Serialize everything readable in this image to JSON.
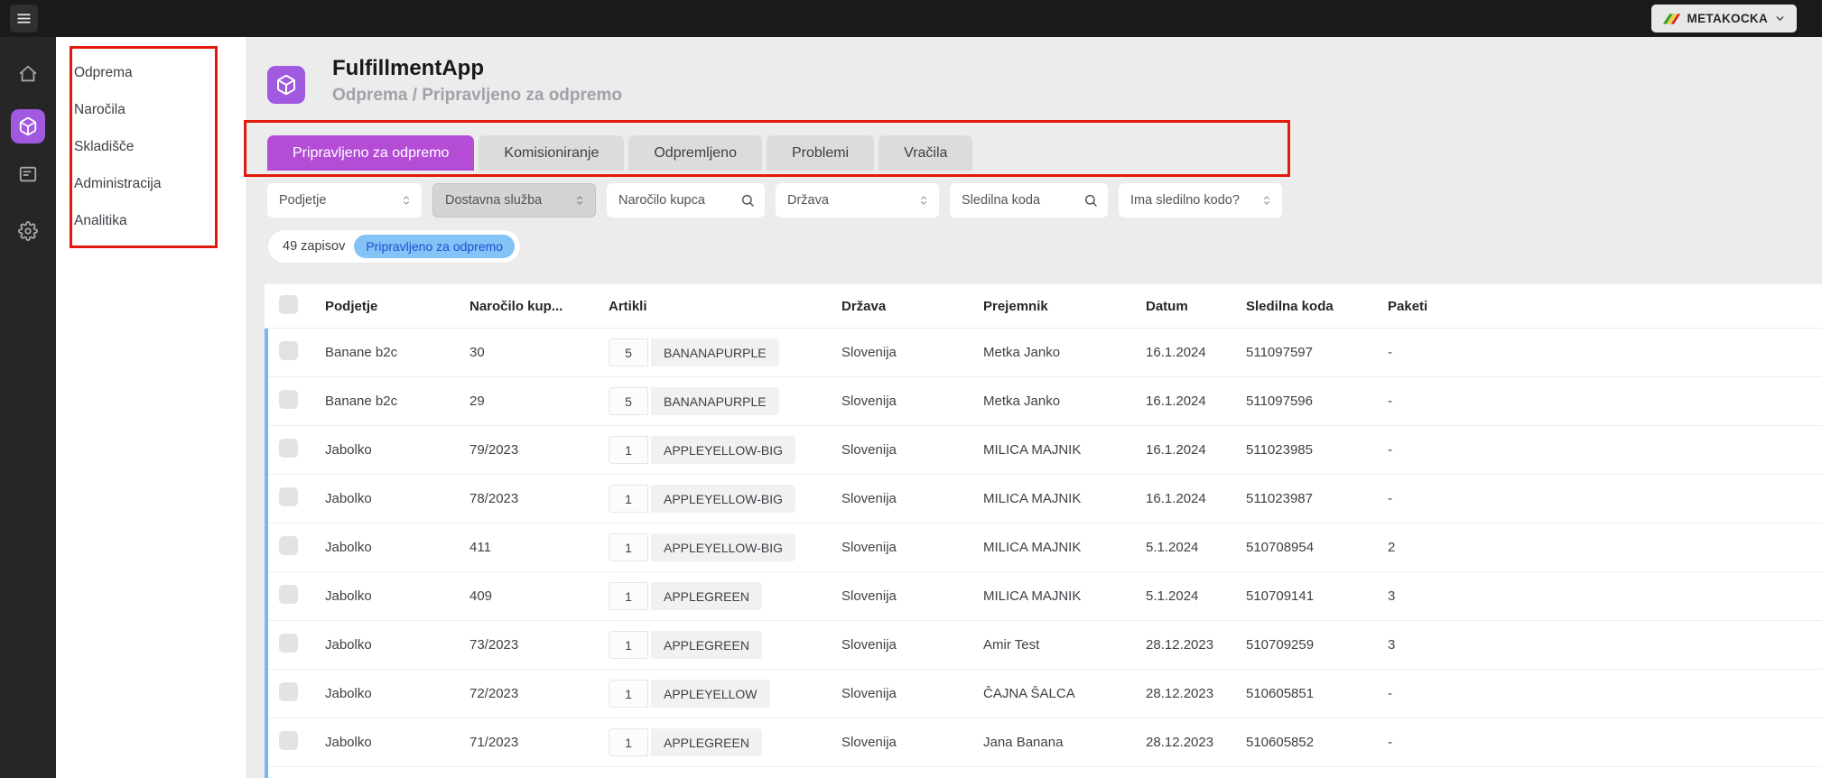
{
  "topbar": {
    "brand": "METAKOCKA"
  },
  "iconbar": {
    "items": [
      {
        "name": "home",
        "active": false
      },
      {
        "name": "fulfillment-cube",
        "active": true
      },
      {
        "name": "forms",
        "active": false
      },
      {
        "name": "settings",
        "active": false
      }
    ]
  },
  "sidebar": {
    "items": [
      {
        "label": "Odprema"
      },
      {
        "label": "Naročila"
      },
      {
        "label": "Skladišče"
      },
      {
        "label": "Administracija"
      },
      {
        "label": "Analitika"
      }
    ]
  },
  "header": {
    "title": "FulfillmentApp",
    "breadcrumb": "Odprema / Pripravljeno za odpremo"
  },
  "tabs": [
    {
      "label": "Pripravljeno za odpremo",
      "active": true
    },
    {
      "label": "Komisioniranje",
      "active": false
    },
    {
      "label": "Odpremljeno",
      "active": false
    },
    {
      "label": "Problemi",
      "active": false
    },
    {
      "label": "Vračila",
      "active": false
    }
  ],
  "filters": [
    {
      "label": "Podjetje",
      "type": "select"
    },
    {
      "label": "Dostavna služba",
      "type": "select",
      "disabled": true
    },
    {
      "label": "Naročilo kupca",
      "type": "search",
      "value": ""
    },
    {
      "label": "Država",
      "type": "select"
    },
    {
      "label": "Sledilna koda",
      "type": "search",
      "value": ""
    },
    {
      "label": "Ima sledilno kodo?",
      "type": "select"
    }
  ],
  "results": {
    "count_label": "49 zapisov",
    "status_label": "Pripravljeno za odpremo"
  },
  "table": {
    "columns": [
      "Podjetje",
      "Naročilo kup...",
      "Artikli",
      "Država",
      "Prejemnik",
      "Datum",
      "Sledilna koda",
      "Paketi"
    ],
    "rows": [
      {
        "podjetje": "Banane b2c",
        "narocilo": "30",
        "qty": "5",
        "artikel": "BANANAPURPLE",
        "drzava": "Slovenija",
        "prejemnik": "Metka Janko",
        "datum": "16.1.2024",
        "sledilna": "511097597",
        "paketi": "-"
      },
      {
        "podjetje": "Banane b2c",
        "narocilo": "29",
        "qty": "5",
        "artikel": "BANANAPURPLE",
        "drzava": "Slovenija",
        "prejemnik": "Metka Janko",
        "datum": "16.1.2024",
        "sledilna": "511097596",
        "paketi": "-"
      },
      {
        "podjetje": "Jabolko",
        "narocilo": "79/2023",
        "qty": "1",
        "artikel": "APPLEYELLOW-BIG",
        "drzava": "Slovenija",
        "prejemnik": "MILICA MAJNIK",
        "datum": "16.1.2024",
        "sledilna": "511023985",
        "paketi": "-"
      },
      {
        "podjetje": "Jabolko",
        "narocilo": "78/2023",
        "qty": "1",
        "artikel": "APPLEYELLOW-BIG",
        "drzava": "Slovenija",
        "prejemnik": "MILICA MAJNIK",
        "datum": "16.1.2024",
        "sledilna": "511023987",
        "paketi": "-"
      },
      {
        "podjetje": "Jabolko",
        "narocilo": "411",
        "qty": "1",
        "artikel": "APPLEYELLOW-BIG",
        "drzava": "Slovenija",
        "prejemnik": "MILICA MAJNIK",
        "datum": "5.1.2024",
        "sledilna": "510708954",
        "paketi": "2"
      },
      {
        "podjetje": "Jabolko",
        "narocilo": "409",
        "qty": "1",
        "artikel": "APPLEGREEN",
        "drzava": "Slovenija",
        "prejemnik": "MILICA MAJNIK",
        "datum": "5.1.2024",
        "sledilna": "510709141",
        "paketi": "3"
      },
      {
        "podjetje": "Jabolko",
        "narocilo": "73/2023",
        "qty": "1",
        "artikel": "APPLEGREEN",
        "drzava": "Slovenija",
        "prejemnik": "Amir Test",
        "datum": "28.12.2023",
        "sledilna": "510709259",
        "paketi": "3"
      },
      {
        "podjetje": "Jabolko",
        "narocilo": "72/2023",
        "qty": "1",
        "artikel": "APPLEYELLOW",
        "drzava": "Slovenija",
        "prejemnik": "ČAJNA ŠALCA",
        "datum": "28.12.2023",
        "sledilna": "510605851",
        "paketi": "-"
      },
      {
        "podjetje": "Jabolko",
        "narocilo": "71/2023",
        "qty": "1",
        "artikel": "APPLEGREEN",
        "drzava": "Slovenija",
        "prejemnik": "Jana Banana",
        "datum": "28.12.2023",
        "sledilna": "510605852",
        "paketi": "-"
      }
    ]
  },
  "colors": {
    "topbar_bg": "#1a1a1a",
    "iconbar_bg": "#262626",
    "page_bg": "#ececec",
    "accent_purple": "#a159e0",
    "tab_active_bg": "#b44cd6",
    "status_badge_bg": "#84c3f5",
    "status_badge_text": "#1c4ed8",
    "row_accent_blue": "#77b6f4",
    "annotation_red": "#e11a0c"
  }
}
